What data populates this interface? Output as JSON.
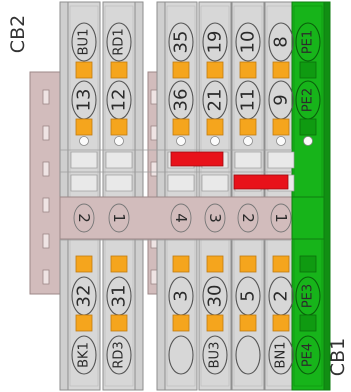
{
  "side_labels": {
    "top": "CB2",
    "bottom": "CB1"
  },
  "colors": {
    "gray_block": "#d7d7d7",
    "gray_stroke": "#8e8e8e",
    "rail": "#d2bcbc",
    "rail_stroke": "#9c8787",
    "green_block": "#17b41a",
    "green_stroke": "#0f7d10",
    "terminal": "#f5a51d",
    "jumper_red": "#e8121a"
  },
  "blocks": [
    {
      "group": "left",
      "top": "BU1",
      "upper": "13",
      "bridge": "2",
      "lower": "32",
      "bottom": "BK1"
    },
    {
      "group": "left",
      "top": "RD1",
      "upper": "12",
      "bridge": "1",
      "lower": "31",
      "bottom": "RD3"
    },
    {
      "group": "right",
      "top": "35",
      "upper": "36",
      "bridge": "4",
      "lower": "3",
      "bottom": ""
    },
    {
      "group": "right",
      "top": "19",
      "upper": "21",
      "bridge": "3",
      "lower": "30",
      "bottom": "BU3"
    },
    {
      "group": "right",
      "top": "10",
      "upper": "11",
      "bridge": "2",
      "lower": "5",
      "bottom": ""
    },
    {
      "group": "right",
      "top": "8",
      "upper": "9",
      "bridge": "1",
      "lower": "2",
      "bottom": "BN1"
    },
    {
      "group": "green",
      "top": "PE1",
      "upper": "PE2",
      "bridge": "",
      "lower": "PE3",
      "bottom": "PE4"
    }
  ]
}
